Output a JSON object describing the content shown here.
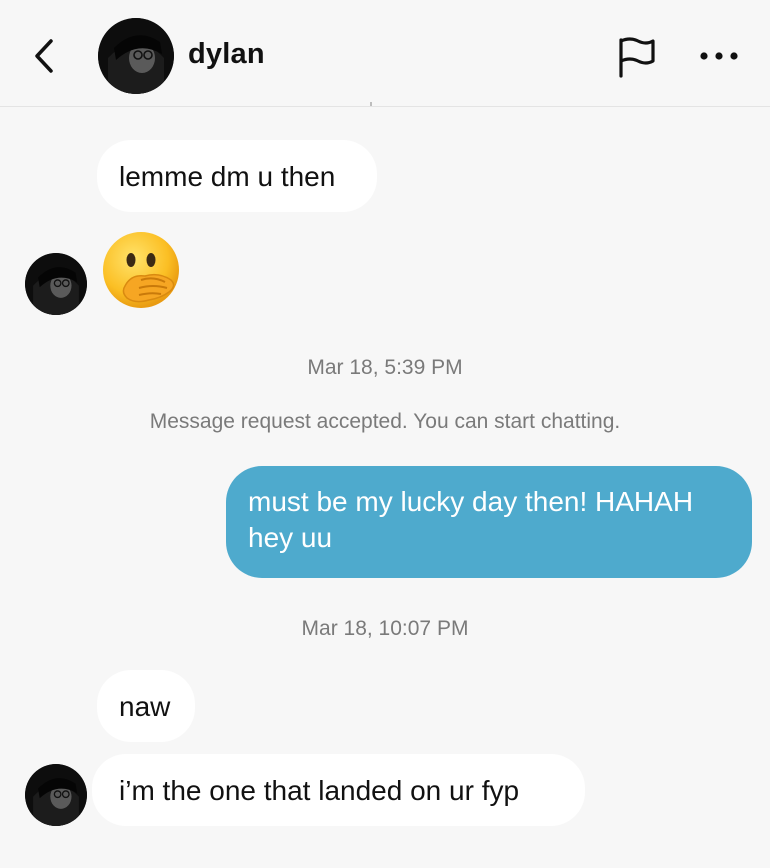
{
  "header": {
    "contact_name": "dylan",
    "icons": [
      "chevron-left-icon",
      "flag-icon",
      "more-icon"
    ]
  },
  "messages": [
    {
      "from": "dylan",
      "text": "lemme dm u then"
    },
    {
      "from": "dylan",
      "emoji": "face-with-hand-over-mouth"
    },
    {
      "from": "me",
      "text": "must be my lucky day then! HAHAH hey uu"
    },
    {
      "from": "dylan",
      "text": "naw"
    },
    {
      "from": "dylan",
      "text": "i’m the one that landed on ur fyp"
    }
  ],
  "timestamps": {
    "first": "Mar 18, 5:39 PM",
    "second": "Mar 18, 10:07 PM"
  },
  "system_notice": "Message request accepted. You can start chatting.",
  "colors": {
    "outgoing_bubble": "#4eaacd",
    "incoming_bubble": "#ffffff",
    "background": "#f7f7f7"
  }
}
